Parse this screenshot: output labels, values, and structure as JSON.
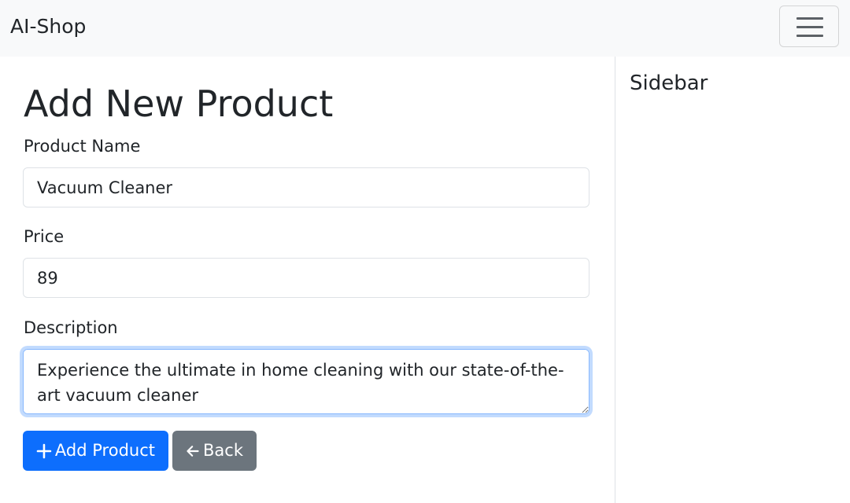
{
  "navbar": {
    "brand": "AI-Shop",
    "toggler_icon": "hamburger-menu-icon"
  },
  "form": {
    "title": "Add New Product",
    "name_label": "Product Name",
    "name_value": "Vacuum Cleaner",
    "price_label": "Price",
    "price_value": "89",
    "description_label": "Description",
    "description_value": "Experience the ultimate in home cleaning with our state-of-the-art vacuum cleaner",
    "add_button_label": "Add Product",
    "add_button_icon": "plus-icon",
    "back_button_label": "Back",
    "back_button_icon": "arrow-left-icon"
  },
  "sidebar": {
    "title": "Sidebar"
  },
  "colors": {
    "primary": "#0d6efd",
    "secondary": "#6c757d",
    "navbar_bg": "#f8f9fa",
    "focus_border": "#86b7fe"
  }
}
